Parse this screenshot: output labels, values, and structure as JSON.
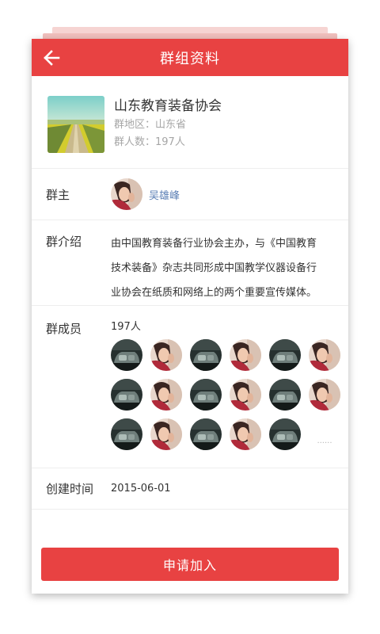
{
  "header": {
    "title": "群组资料",
    "back_icon": "arrow-left-icon"
  },
  "group": {
    "name": "山东教育装备协会",
    "region": "群地区：山东省",
    "members_text": "群人数：197人",
    "thumb_icon": "landscape-field-road"
  },
  "owner": {
    "label": "群主",
    "name": "吴雄峰"
  },
  "intro": {
    "label": "群介绍",
    "lines": [
      "由中国教育装备行业协会主办，与《中国教育",
      "技术装备》杂志共同形成中国教学仪器设备行",
      "业协会在纸质和网络上的两个重要宣传媒体。"
    ]
  },
  "members": {
    "label": "群成员",
    "count": "197人",
    "avatars": [
      "dark",
      "woman",
      "dark",
      "woman",
      "dark",
      "woman",
      "dark",
      "woman",
      "dark",
      "woman",
      "dark",
      "woman",
      "dark",
      "woman",
      "dark",
      "woman",
      "dark"
    ],
    "more": "......"
  },
  "created": {
    "label": "创建时间",
    "date": "2015-06-01"
  },
  "action": {
    "join_label": "申请加入"
  },
  "colors": {
    "accent": "#e84242",
    "link": "#5b7fb5",
    "muted": "#a6a6a6"
  }
}
